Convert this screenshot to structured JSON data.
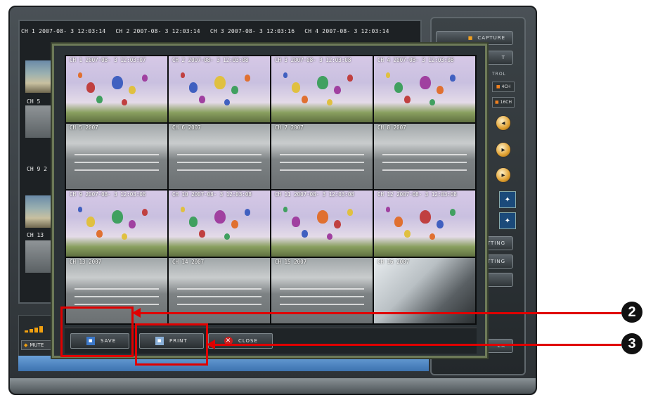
{
  "background_window": {
    "channel_titles": [
      "CH 1 2007-08- 3 12:03:14",
      "CH 2 2007-08- 3 12:03:14",
      "CH 3 2007-08- 3 12:03:16",
      "CH 4 2007-08- 3 12:03:14"
    ],
    "side_labels": [
      "CH 5",
      "CH 9 2",
      "CH 13"
    ]
  },
  "right_panel": {
    "buttons": [
      "CAPTURE",
      "T",
      "ITTING",
      "ETTING",
      "",
      "ER"
    ],
    "control_label": "TROL",
    "split_buttons": [
      "4CH",
      "16CH"
    ]
  },
  "audio": {
    "mute_label": "MUTE"
  },
  "popup": {
    "cells": [
      {
        "label": "CH 1 2007-08- 3 12:03:07",
        "scene": "balloon"
      },
      {
        "label": "CH 2 2007-08- 3 12:03:08",
        "scene": "balloon"
      },
      {
        "label": "CH 3 2007-08- 3 12:03:08",
        "scene": "balloon"
      },
      {
        "label": "CH 4 2007-08- 3 12:03:08",
        "scene": "balloon"
      },
      {
        "label": "CH 5 2007",
        "scene": "street"
      },
      {
        "label": "CH 6 2007",
        "scene": "street"
      },
      {
        "label": "CH 7 2007",
        "scene": "street"
      },
      {
        "label": "CH 8 2007",
        "scene": "street"
      },
      {
        "label": "CH 9 2007-08- 3 12:03:08",
        "scene": "balloon"
      },
      {
        "label": "CH 10 2007-08- 3 12:03:08",
        "scene": "balloon"
      },
      {
        "label": "CH 11 2007-08- 3 12:03:08",
        "scene": "balloon"
      },
      {
        "label": "CH 12 2007-08- 3 12:03:08",
        "scene": "balloon"
      },
      {
        "label": "CH 13 2007",
        "scene": "street"
      },
      {
        "label": "CH 14 2007",
        "scene": "street"
      },
      {
        "label": "CH 15 2007",
        "scene": "street"
      },
      {
        "label": "CH 16 2007",
        "scene": "room"
      }
    ],
    "save_label": "SAVE",
    "print_label": "PRINT",
    "close_label": "CLOSE"
  },
  "callouts": {
    "callout_2": "2",
    "callout_3": "3"
  },
  "colors": {
    "annotation_red": "#e00000",
    "frame_gray": "#3c4347"
  }
}
